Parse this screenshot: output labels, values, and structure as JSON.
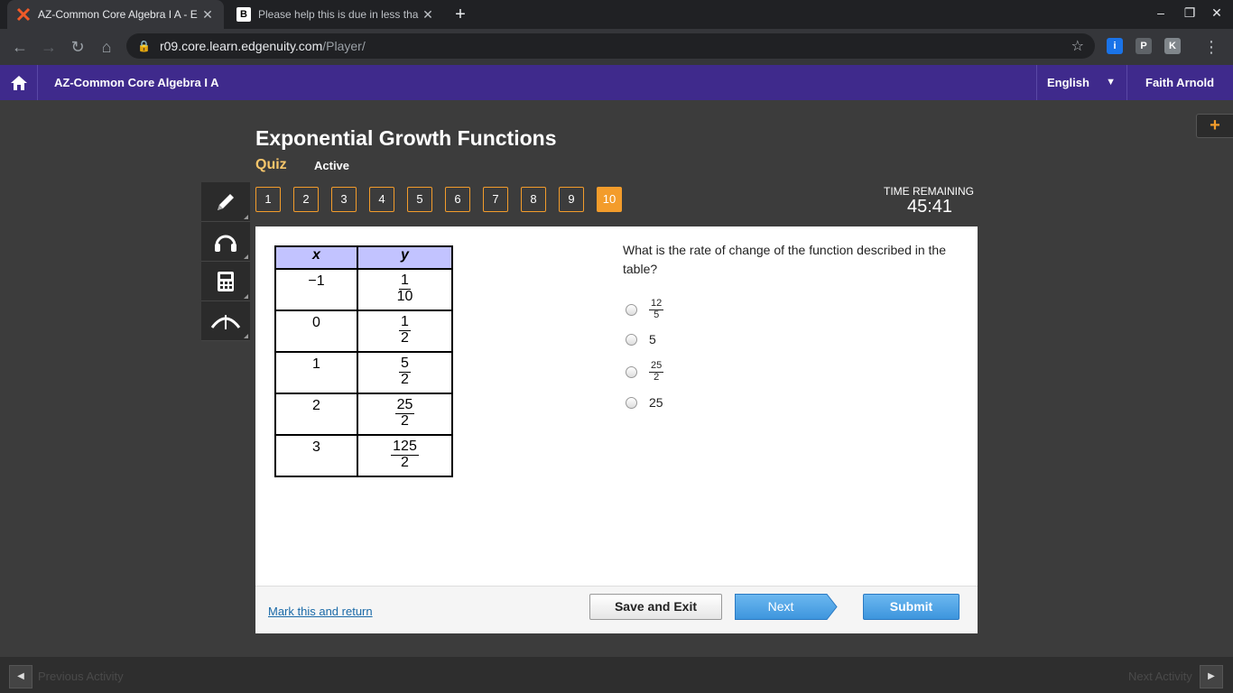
{
  "browser": {
    "tabs": [
      {
        "title": "AZ-Common Core Algebra I A - E",
        "active": true
      },
      {
        "title": "Please help this is due in less tha",
        "active": false
      }
    ],
    "url_host": "r09.core.learn.edgenuity.com",
    "url_path": "/Player/"
  },
  "header": {
    "course": "AZ-Common Core Algebra I A",
    "language": "English",
    "user": "Faith Arnold",
    "accent": "#3f2a8c"
  },
  "activity": {
    "title": "Exponential Growth Functions",
    "type": "Quiz",
    "status": "Active"
  },
  "questions": [
    "1",
    "2",
    "3",
    "4",
    "5",
    "6",
    "7",
    "8",
    "9",
    "10"
  ],
  "current_question": "10",
  "timer": {
    "label": "TIME REMAINING",
    "value": "45:41"
  },
  "table": {
    "headers": [
      "x",
      "y"
    ],
    "rows": [
      {
        "x": "−1",
        "num": "1",
        "den": "10"
      },
      {
        "x": "0",
        "num": "1",
        "den": "2"
      },
      {
        "x": "1",
        "num": "5",
        "den": "2"
      },
      {
        "x": "2",
        "num": "25",
        "den": "2"
      },
      {
        "x": "3",
        "num": "125",
        "den": "2"
      }
    ]
  },
  "question": "What is the rate of change of the function described in the table?",
  "options": [
    {
      "num": "12",
      "den": "5"
    },
    {
      "text": "5"
    },
    {
      "num": "25",
      "den": "2"
    },
    {
      "text": "25"
    }
  ],
  "footer": {
    "mark": "Mark this and return",
    "save": "Save and Exit",
    "next": "Next",
    "submit": "Submit"
  },
  "bottom": {
    "prev": "Previous Activity",
    "next": "Next Activity"
  }
}
